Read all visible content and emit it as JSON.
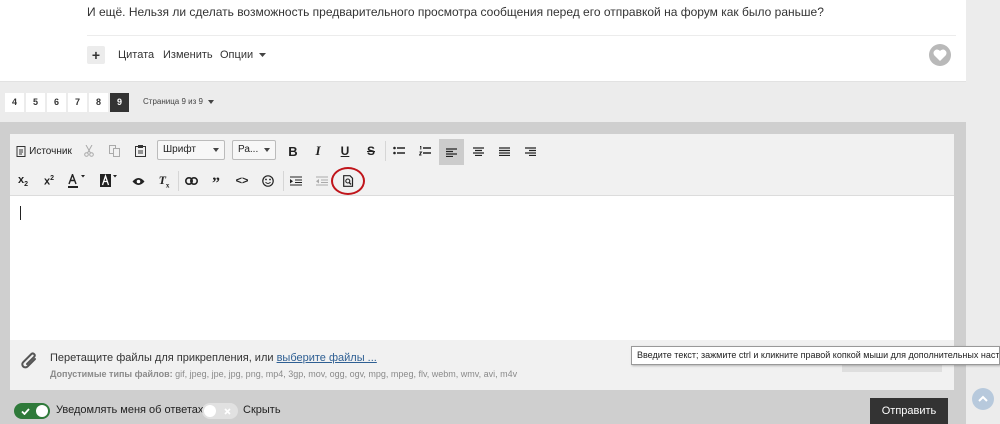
{
  "post": {
    "text": "И ещё. Нельзя ли сделать возможность предварительного просмотра сообщения перед его отправкой на форум как было раньше?",
    "plus": "+",
    "quote": "Цитата",
    "edit": "Изменить",
    "options": "Опции"
  },
  "pagination": {
    "pages": [
      "4",
      "5",
      "6",
      "7",
      "8",
      "9"
    ],
    "current": "9",
    "info": "Страница 9 из 9"
  },
  "toolbar": {
    "source": "Источник",
    "font": "Шрифт",
    "size": "Ра..."
  },
  "attach": {
    "hint": "Перетащите файлы для прикрепления, или ",
    "link": "выберите файлы ...",
    "types_label": "Допустимые типы файлов:",
    "types": " gif, jpeg, jpe, jpg, png, mp4, 3gp, mov, ogg, ogv, mpg, mpeg, flv, webm, wmv, avi, m4v"
  },
  "tooltip": "Введите текст; зажмите ctrl и кликните правой копкой мыши для дополнительных настроек",
  "notify_label": "Уведомлять меня об ответах",
  "hide_label": "Скрыть",
  "submit": "Отправить",
  "colors": {
    "accent": "#2f7a3a",
    "dark": "#333333",
    "highlight": "#c0151b"
  }
}
